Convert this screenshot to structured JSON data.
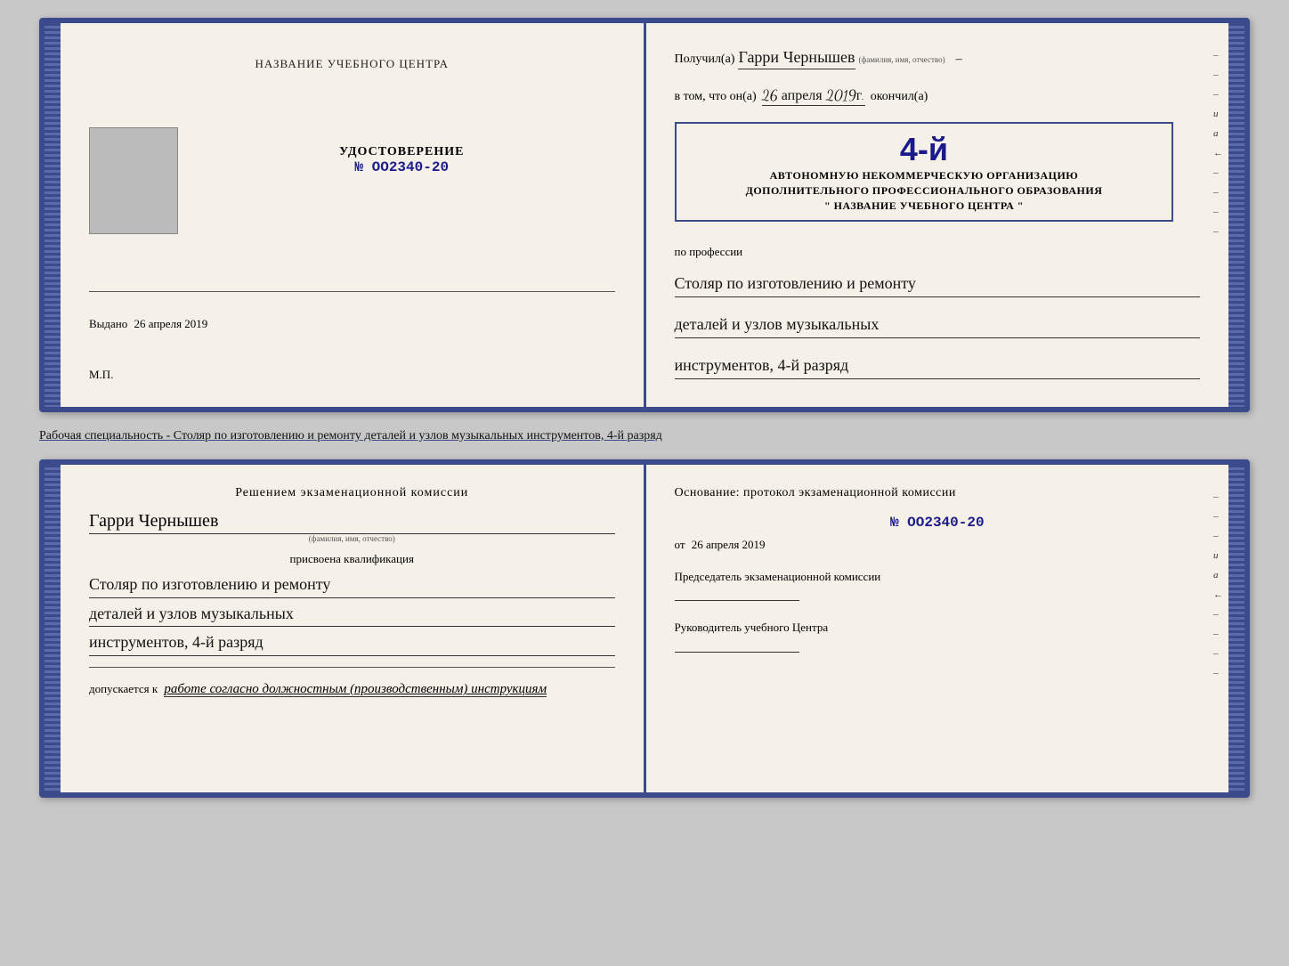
{
  "top_document": {
    "left": {
      "center_title": "НАЗВАНИЕ УЧЕБНОГО ЦЕНТРА",
      "udostoverenie_title": "УДОСТОВЕРЕНИЕ",
      "udostoverenie_number": "№ OO2340-20",
      "vydano_label": "Выдано",
      "vydano_date": "26 апреля 2019",
      "mp": "М.П."
    },
    "right": {
      "poluchil_label": "Получил(а)",
      "recipient_name": "Гарри Чернышев",
      "fio_label": "(фамилия, имя, отчество)",
      "vtom_label": "в том, что он(а)",
      "vtom_date": "26 апреля 2019г.",
      "okonchil_label": "окончил(а)",
      "stamp_num": "4-й",
      "stamp_line1": "АВТОНОМНУЮ НЕКОММЕРЧЕСКУЮ ОРГАНИЗАЦИЮ",
      "stamp_line2": "ДОПОЛНИТЕЛЬНОГО ПРОФЕССИОНАЛЬНОГО ОБРАЗОВАНИЯ",
      "stamp_line3": "\" НАЗВАНИЕ УЧЕБНОГО ЦЕНТРА \"",
      "profession_label": "по профессии",
      "profession_line1": "Столяр по изготовлению и ремонту",
      "profession_line2": "деталей и узлов музыкальных",
      "profession_line3": "инструментов, 4-й разряд"
    }
  },
  "between_text": "Рабочая специальность - Столяр по изготовлению и ремонту деталей и узлов музыкальных инструментов, 4-й разряд",
  "bottom_document": {
    "left": {
      "decision_title": "Решением  экзаменационной  комиссии",
      "name": "Гарри Чернышев",
      "fio_label": "(фамилия, имя, отчество)",
      "prisvoena_label": "присвоена квалификация",
      "qualification_line1": "Столяр по изготовлению и ремонту",
      "qualification_line2": "деталей и узлов музыкальных",
      "qualification_line3": "инструментов, 4-й разряд",
      "dopuskaetsya_label": "допускается к",
      "dopuskaetsya_text": "работе согласно должностным (производственным) инструкциям"
    },
    "right": {
      "osnov_label": "Основание:  протокол  экзаменационной  комиссии",
      "protocol_num": "№  OO2340-20",
      "ot_label": "от",
      "ot_date": "26 апреля 2019",
      "chairman_label": "Председатель экзаменационной комиссии",
      "rukov_label": "Руководитель учебного Центра"
    }
  },
  "right_margin_marks": [
    "–",
    "–",
    "–",
    "и",
    "а",
    "←",
    "–",
    "–",
    "–",
    "–"
  ]
}
